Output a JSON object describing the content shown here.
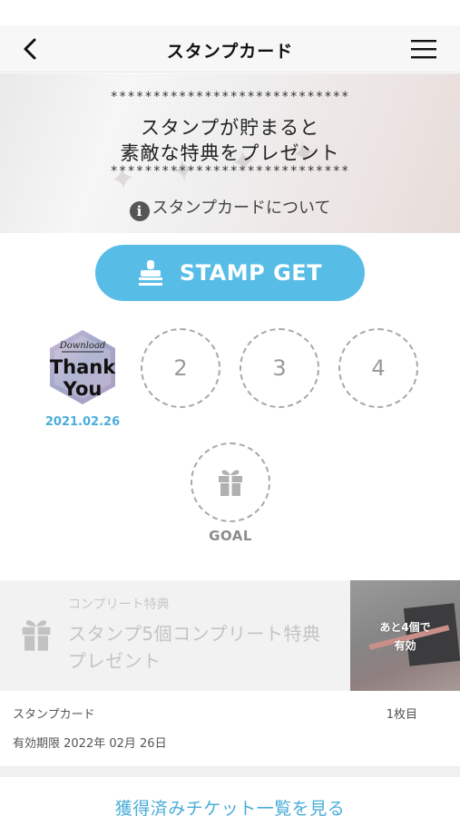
{
  "header": {
    "title": "スタンプカード",
    "back_icon": "chevron-left-icon",
    "menu_icon": "hamburger-menu-icon"
  },
  "banner": {
    "stars_top": "****************************",
    "message_line1": "スタンプが貯まると",
    "message_line2": "素敵な特典をプレゼント",
    "stars_bottom": "****************************",
    "about_label": "スタンプカードについて",
    "about_icon": "info-icon"
  },
  "stamp_get": {
    "label": "STAMP GET",
    "icon": "stamp-icon",
    "color": "#58bde6"
  },
  "stamps": {
    "first": {
      "title": "Download",
      "text_line1": "Thank",
      "text_line2": "You",
      "date": "2021.02.26"
    },
    "slot2": "2",
    "slot3": "3",
    "slot4": "4",
    "goal_icon": "gift-icon",
    "goal_label": "GOAL"
  },
  "reward": {
    "category": "コンプリート特典",
    "name_line1": "スタンプ5個コンプリート特典",
    "name_line2": "プレゼント",
    "remaining_line1": "あと4個で",
    "remaining_line2": "有効",
    "icon": "gift-icon"
  },
  "card": {
    "label": "スタンプカード",
    "count": "1枚目",
    "expiry": "有効期限 2022年 02月 26日"
  },
  "footer": {
    "link": "獲得済みチケット一覧を見る"
  },
  "colors": {
    "accent": "#58bde6",
    "date": "#4aaed8",
    "slot_border": "#a8a8a8"
  }
}
